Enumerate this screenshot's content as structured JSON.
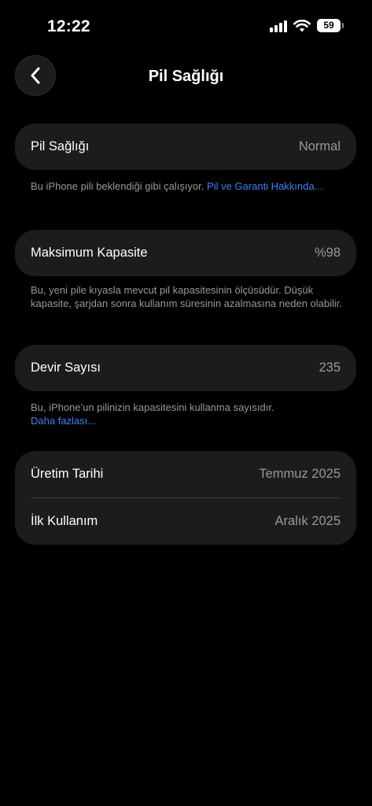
{
  "status_bar": {
    "time": "12:22",
    "battery_level": "59",
    "icons": [
      "cellular-signal-icon",
      "wifi-icon",
      "battery-icon"
    ]
  },
  "nav": {
    "title": "Pil Sağlığı",
    "back_icon": "chevron-left-icon"
  },
  "battery_health": {
    "label": "Pil Sağlığı",
    "value": "Normal",
    "footnote": "Bu iPhone pili beklendiği gibi çalışıyor. ",
    "footnote_link": "Pil ve Garanti Hakkında..."
  },
  "max_capacity": {
    "label": "Maksimum Kapasite",
    "value": "%98",
    "footnote": "Bu, yeni pile kıyasla mevcut pil kapasitesinin ölçüsüdür. Düşük kapasite, şarjdan sonra kullanım süresinin azalmasına neden olabilir."
  },
  "cycle_count": {
    "label": "Devir Sayısı",
    "value": "235",
    "footnote": "Bu, iPhone'un pilinizin kapasitesini kullanma sayısıdır.",
    "footnote_link": "Daha fazlası..."
  },
  "dates": {
    "manufacture_label": "Üretim Tarihi",
    "manufacture_value": "Temmuz 2025",
    "first_use_label": "İlk Kullanım",
    "first_use_value": "Aralık 2025"
  },
  "colors": {
    "background": "#000000",
    "card": "#1c1c1e",
    "secondary_text": "#98989d",
    "link": "#3b82f6"
  }
}
